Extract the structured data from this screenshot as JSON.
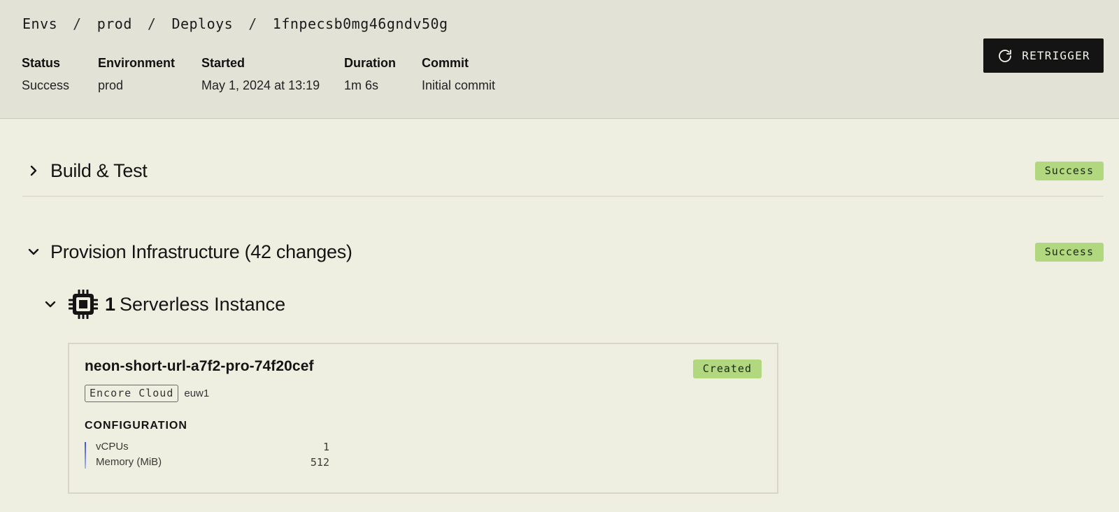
{
  "breadcrumb": {
    "items": [
      "Envs",
      "prod",
      "Deploys",
      "1fnpecsb0mg46gndv50g"
    ],
    "separator": "/"
  },
  "meta": {
    "status": {
      "label": "Status",
      "value": "Success"
    },
    "environment": {
      "label": "Environment",
      "value": "prod"
    },
    "started": {
      "label": "Started",
      "value": "May 1, 2024 at 13:19"
    },
    "duration": {
      "label": "Duration",
      "value": "1m 6s"
    },
    "commit": {
      "label": "Commit",
      "value": "Initial commit"
    }
  },
  "actions": {
    "retrigger_label": "RETRIGGER",
    "retrigger_icon": "refresh-icon"
  },
  "sections": {
    "build": {
      "title": "Build & Test",
      "status": "Success",
      "expanded": false
    },
    "provision": {
      "title": "Provision Infrastructure (42 changes)",
      "status": "Success",
      "expanded": true
    }
  },
  "group": {
    "count": "1",
    "title": "Serverless Instance",
    "icon": "cpu-icon",
    "expanded": true
  },
  "resource": {
    "name": "neon-short-url-a7f2-pro-74f20cef",
    "status": "Created",
    "provider": "Encore Cloud",
    "region": "euw1",
    "config_heading": "CONFIGURATION",
    "config": [
      {
        "key": "vCPUs",
        "value": "1"
      },
      {
        "key": "Memory (MiB)",
        "value": "512"
      }
    ]
  },
  "colors": {
    "page_bg": "#eeeee1",
    "header_bg": "#e3e2d6",
    "badge_bg": "#b1d77f",
    "button_bg": "#141414",
    "accent_bar": "#3a4fd8"
  }
}
